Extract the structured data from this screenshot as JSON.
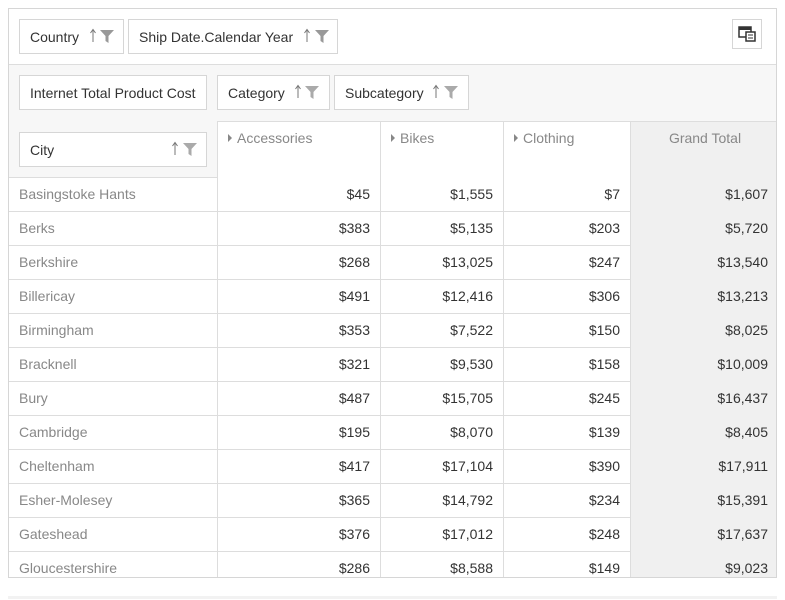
{
  "filters": {
    "country": "Country",
    "ship_date": "Ship Date.Calendar Year"
  },
  "data_field": "Internet Total Product Cost",
  "column_fields": {
    "category": "Category",
    "subcategory": "Subcategory"
  },
  "row_field": "City",
  "columns": [
    "Accessories",
    "Bikes",
    "Clothing"
  ],
  "grand_total_label": "Grand Total",
  "rows": [
    {
      "city": "Basingstoke Hants",
      "values": [
        "$45",
        "$1,555",
        "$7"
      ],
      "total": "$1,607"
    },
    {
      "city": "Berks",
      "values": [
        "$383",
        "$5,135",
        "$203"
      ],
      "total": "$5,720"
    },
    {
      "city": "Berkshire",
      "values": [
        "$268",
        "$13,025",
        "$247"
      ],
      "total": "$13,540"
    },
    {
      "city": "Billericay",
      "values": [
        "$491",
        "$12,416",
        "$306"
      ],
      "total": "$13,213"
    },
    {
      "city": "Birmingham",
      "values": [
        "$353",
        "$7,522",
        "$150"
      ],
      "total": "$8,025"
    },
    {
      "city": "Bracknell",
      "values": [
        "$321",
        "$9,530",
        "$158"
      ],
      "total": "$10,009"
    },
    {
      "city": "Bury",
      "values": [
        "$487",
        "$15,705",
        "$245"
      ],
      "total": "$16,437"
    },
    {
      "city": "Cambridge",
      "values": [
        "$195",
        "$8,070",
        "$139"
      ],
      "total": "$8,405"
    },
    {
      "city": "Cheltenham",
      "values": [
        "$417",
        "$17,104",
        "$390"
      ],
      "total": "$17,911"
    },
    {
      "city": "Esher-Molesey",
      "values": [
        "$365",
        "$14,792",
        "$234"
      ],
      "total": "$15,391"
    },
    {
      "city": "Gateshead",
      "values": [
        "$376",
        "$17,012",
        "$248"
      ],
      "total": "$17,637"
    },
    {
      "city": "Gloucestershire",
      "values": [
        "$286",
        "$8,588",
        "$149"
      ],
      "total": "$9,023"
    }
  ],
  "icons": {
    "sort": "sort-arrow-icon",
    "filter": "filter-funnel-icon",
    "field_chooser": "field-chooser-icon",
    "expand": "expand-triangle-icon"
  },
  "colors": {
    "border": "#d6d6d6",
    "header_bg": "#f7f7f7",
    "total_bg": "#f0f0f0",
    "icon": "#999999"
  }
}
